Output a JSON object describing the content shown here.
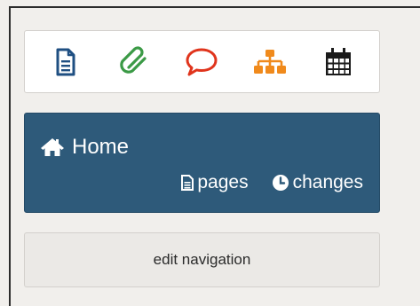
{
  "toolbar": {
    "tools": [
      {
        "icon": "document-icon",
        "color": "#1f4f82"
      },
      {
        "icon": "paperclip-icon",
        "color": "#3b9a46"
      },
      {
        "icon": "speech-bubble-icon",
        "color": "#e0341c"
      },
      {
        "icon": "sitemap-icon",
        "color": "#f08a1c"
      },
      {
        "icon": "calendar-icon",
        "color": "#1a1a1a"
      }
    ]
  },
  "home": {
    "title": "Home",
    "pages_label": "pages",
    "changes_label": "changes",
    "background": "#2e5a7a"
  },
  "edit_navigation_label": "edit navigation"
}
